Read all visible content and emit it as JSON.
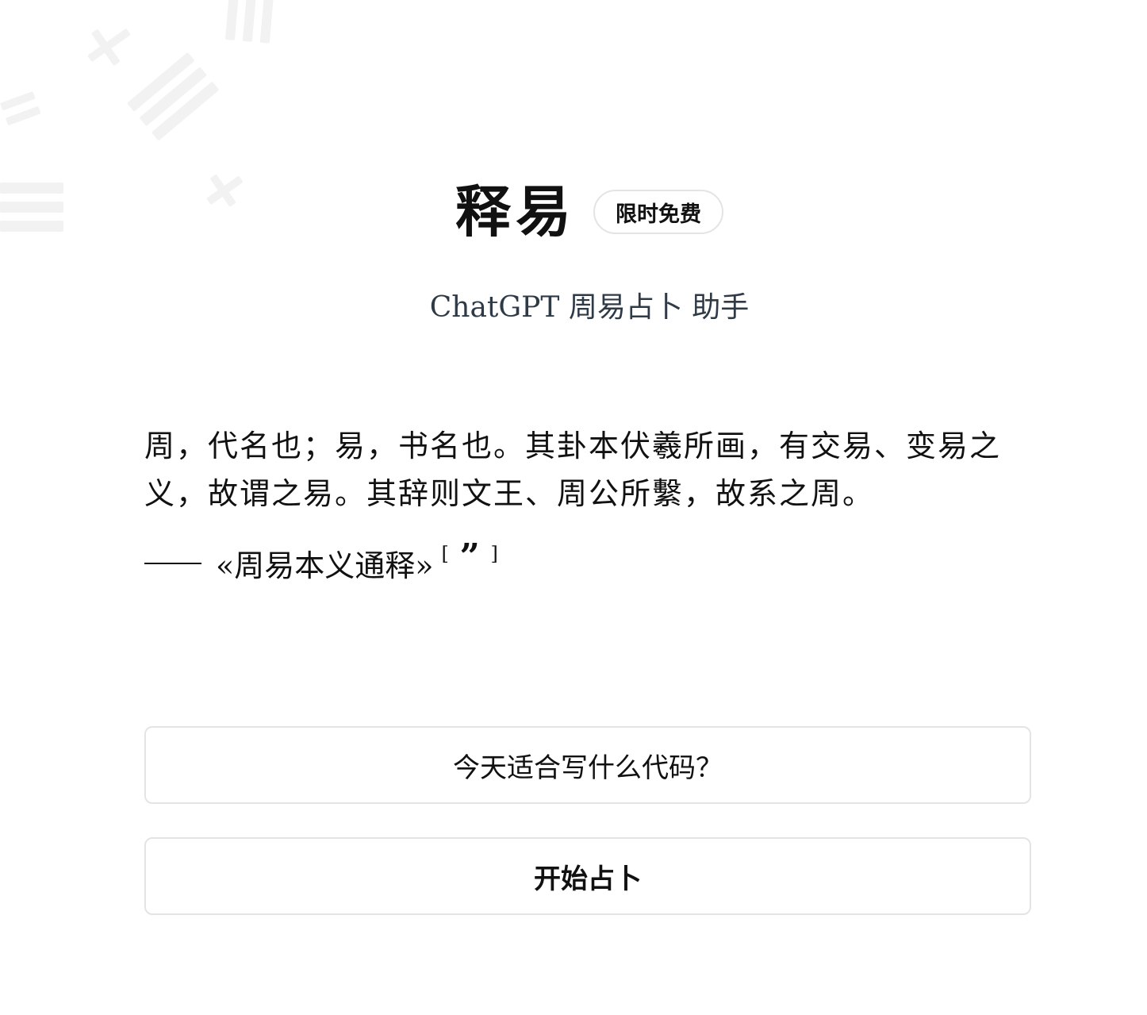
{
  "header": {
    "title": "释易",
    "badge": "限时免费"
  },
  "subtitle": "ChatGPT 周易占卜 助手",
  "quote": {
    "text": "周，代名也；易，书名也。其卦本伏羲所画，有交易、变易之义，故谓之易。其辞则文王、周公所繫，故系之周。",
    "source": "«周易本义通释»",
    "ref_open": "[",
    "ref_glyph": "”",
    "ref_close": "]"
  },
  "actions": {
    "question_label": "今天适合写什么代码？",
    "start_label": "开始占卜"
  },
  "background": {
    "icon": "bagua-icon",
    "color": "#f3f3f3"
  }
}
